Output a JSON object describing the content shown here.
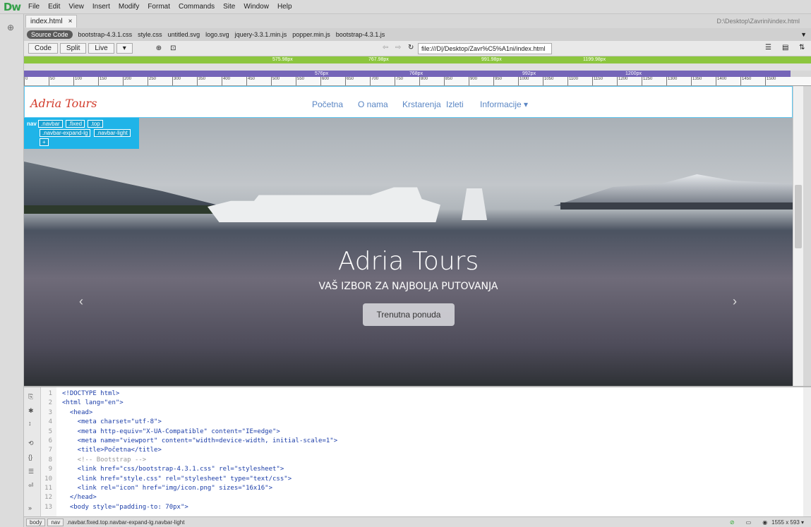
{
  "app": {
    "logo": "Dw",
    "menu": [
      "File",
      "Edit",
      "View",
      "Insert",
      "Modify",
      "Format",
      "Commands",
      "Site",
      "Window",
      "Help"
    ]
  },
  "tab": {
    "name": "index.html",
    "close": "×",
    "path": "D:\\Desktop\\Zavrini\\index.html"
  },
  "files": {
    "source": "Source Code",
    "related": [
      "bootstrap-4.3.1.css",
      "style.css",
      "untitled.svg",
      "logo.svg",
      "jquery-3.3.1.min.js",
      "popper.min.js",
      "bootstrap-4.3.1.js"
    ]
  },
  "toolbar": {
    "code": "Code",
    "split": "Split",
    "live": "Live",
    "url": "file:///D|/Desktop/Zavr%C5%A1ni/index.html"
  },
  "breakpoints": {
    "green": [
      "575.98px",
      "767.98px",
      "991.98px",
      "1199.98px"
    ],
    "purple": [
      "576px",
      "768px",
      "992px",
      "1200px"
    ]
  },
  "ruler": [
    "0",
    "50",
    "100",
    "150",
    "200",
    "250",
    "300",
    "350",
    "400",
    "450",
    "500",
    "550",
    "600",
    "650",
    "700",
    "750",
    "800",
    "850",
    "900",
    "950",
    "1000",
    "1050",
    "1100",
    "1150",
    "1200",
    "1250",
    "1300",
    "1350",
    "1400",
    "1450",
    "1500"
  ],
  "site": {
    "brand": "Adria Tours",
    "nav": [
      "Početna",
      "O nama",
      "Krstarenja",
      "Izleti",
      "Informacije ▾"
    ],
    "hero": {
      "title": "Adria Tours",
      "subtitle": "VAŠ IZBOR ZA NAJBOLJA PUTOVANJA",
      "button": "Trenutna ponuda"
    }
  },
  "navtag": {
    "tag": "nav",
    "classes": [
      ".navbar",
      ".fixed",
      ".top",
      ".navbar-expand-lg",
      ".navbar-light"
    ],
    "add": "+"
  },
  "code": [
    "<!DOCTYPE html>",
    "<html lang=\"en\">",
    "  <head>",
    "    <meta charset=\"utf-8\">",
    "    <meta http-equiv=\"X-UA-Compatible\" content=\"IE=edge\">",
    "    <meta name=\"viewport\" content=\"width=device-width, initial-scale=1\">",
    "    <title>Početna</title>",
    "    <!-- Bootstrap -->",
    "    <link href=\"css/bootstrap-4.3.1.css\" rel=\"stylesheet\">",
    "    <link href=\"style.css\" rel=\"stylesheet\" type=\"text/css\">",
    "    <link rel=\"icon\" href=\"img/icon.png\" sizes=\"16x16\">",
    "  </head>",
    "  <body style=\"padding-to: 70px\">"
  ],
  "status": {
    "crumbs": [
      "body",
      "nav",
      ".navbar.fixed.top.navbar-expand-lg.navbar-light"
    ],
    "dims": "1555 x 593 ▾"
  }
}
